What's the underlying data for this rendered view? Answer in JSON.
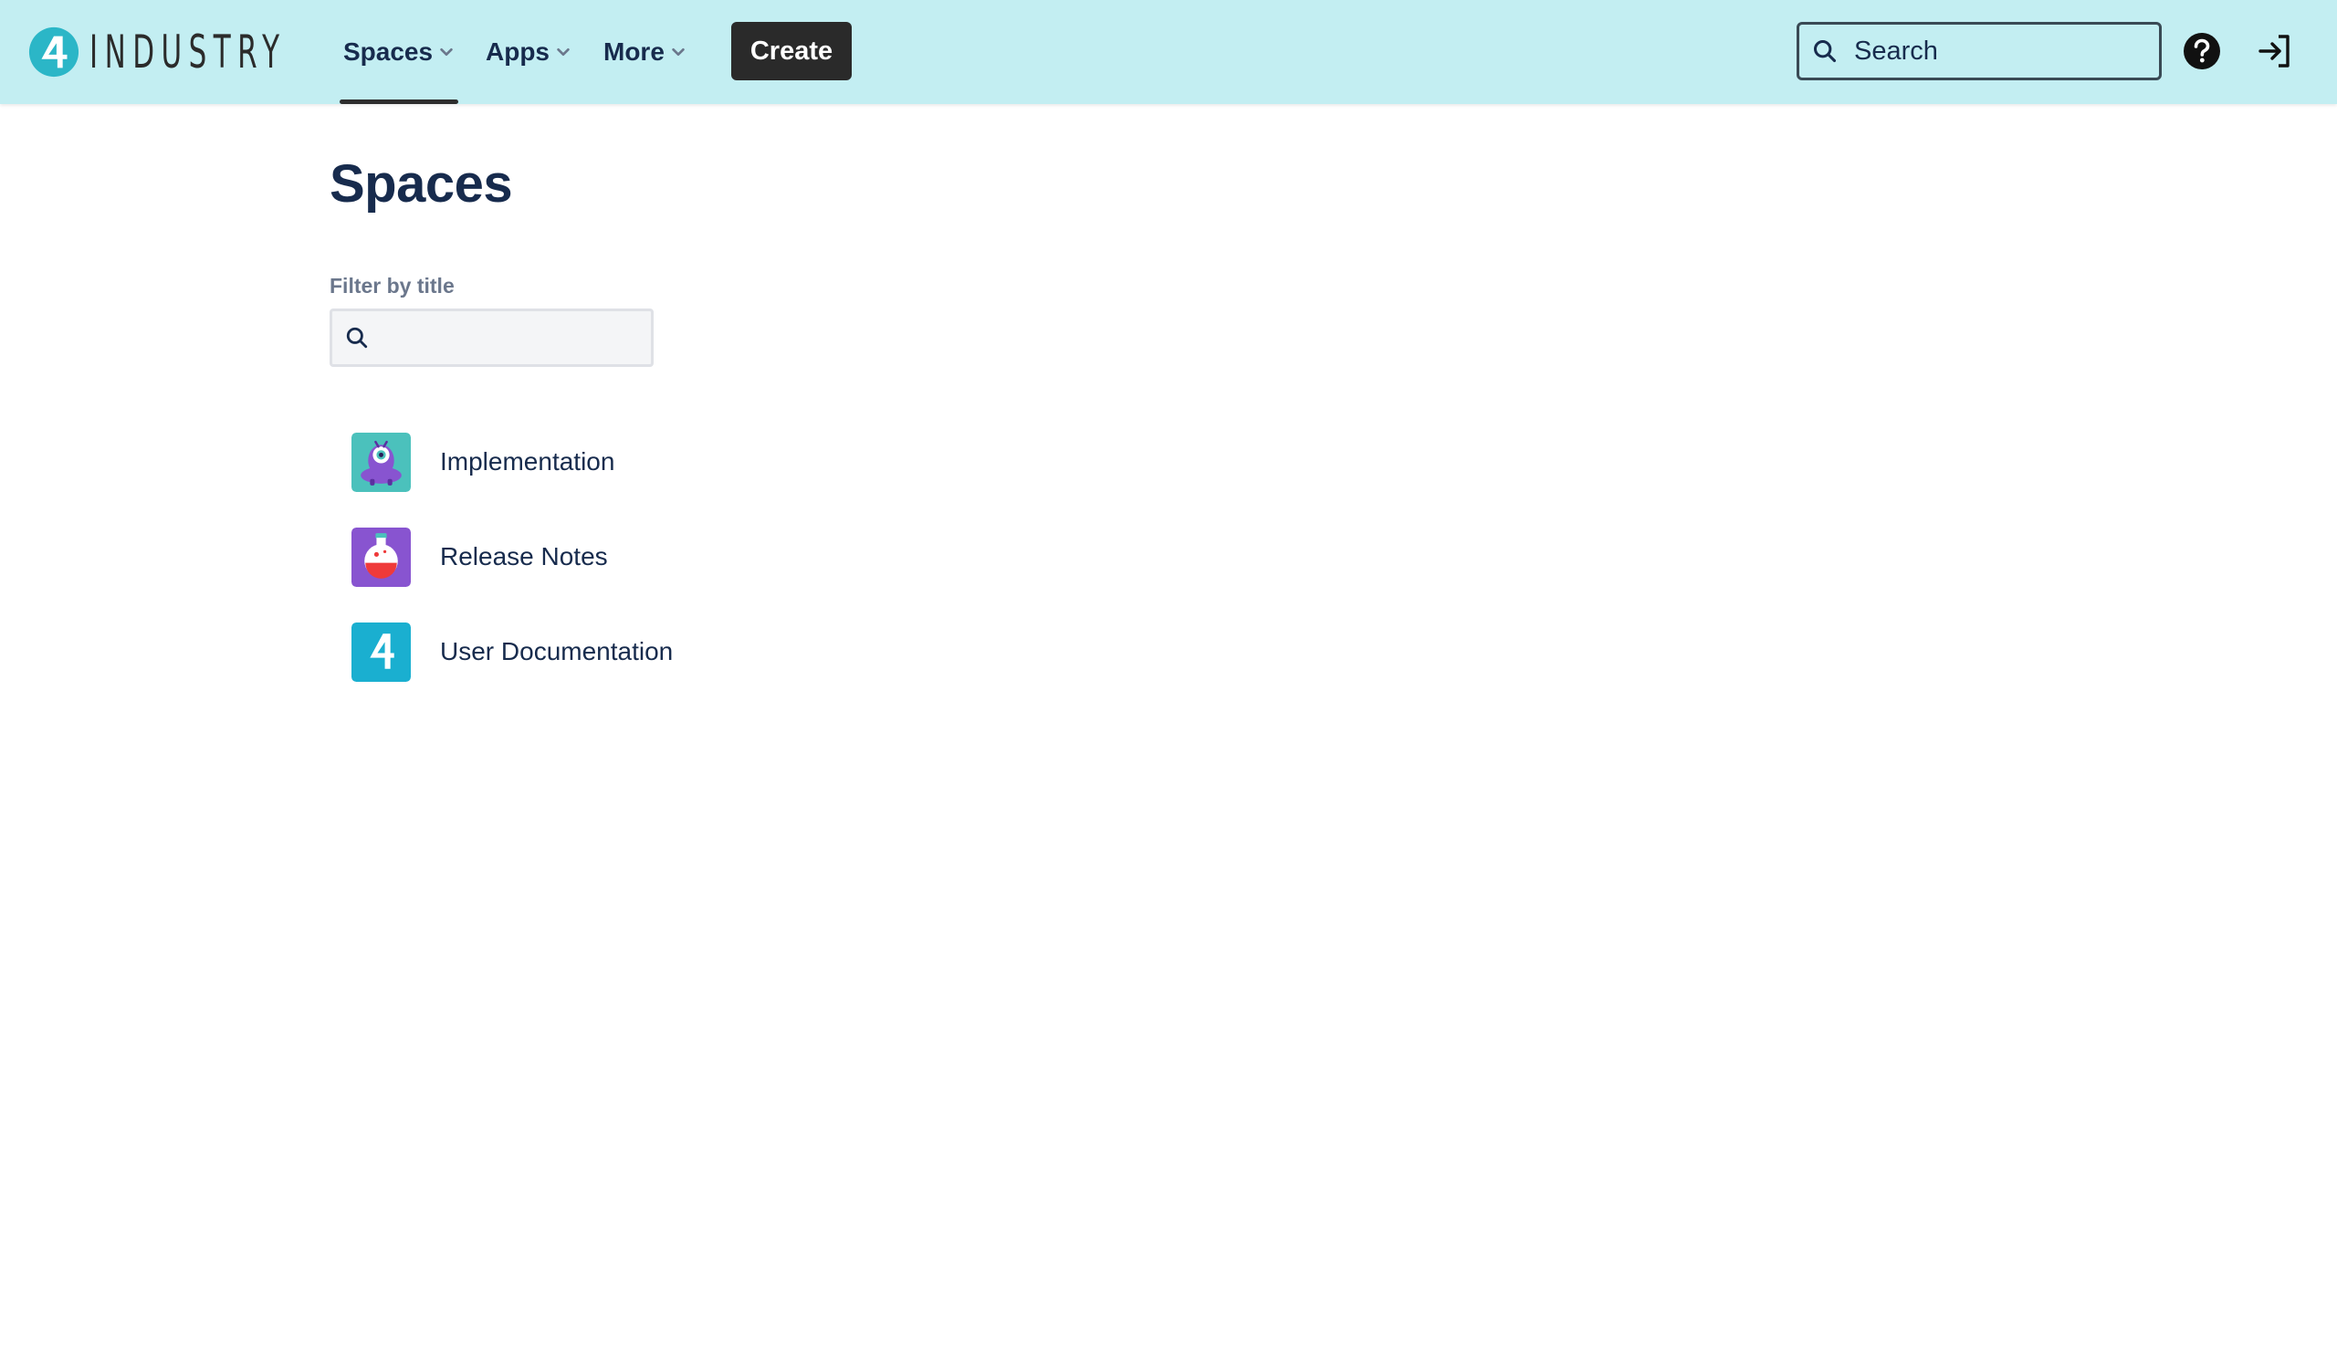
{
  "header": {
    "logo_text": "INDUSTRY",
    "nav": [
      {
        "label": "Spaces",
        "active": true
      },
      {
        "label": "Apps",
        "active": false
      },
      {
        "label": "More",
        "active": false
      }
    ],
    "create_label": "Create",
    "search": {
      "placeholder": "Search",
      "value": ""
    },
    "icons": [
      "help-icon",
      "login-icon"
    ]
  },
  "main": {
    "title": "Spaces",
    "filter": {
      "label": "Filter by title",
      "value": ""
    },
    "spaces": [
      {
        "name": "Implementation",
        "icon": "alien-avatar-icon",
        "color": "#4BC1BC"
      },
      {
        "name": "Release Notes",
        "icon": "potion-avatar-icon",
        "color": "#8854D0"
      },
      {
        "name": "User Documentation",
        "icon": "4industry-avatar-icon",
        "color": "#1AAFD0"
      }
    ]
  },
  "colors": {
    "header_bg": "#C3EEF2",
    "create_bg": "#2A2A2A",
    "text": "#172B4D",
    "muted": "#6B778C"
  }
}
